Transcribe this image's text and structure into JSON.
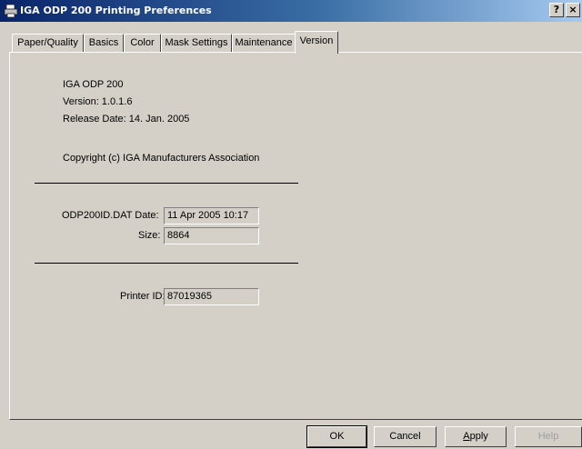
{
  "window": {
    "title": "IGA ODP 200 Printing Preferences",
    "help_button": "?",
    "close_button": "×"
  },
  "tabs": [
    {
      "label": "Paper/Quality"
    },
    {
      "label": "Basics"
    },
    {
      "label": "Color"
    },
    {
      "label": "Mask Settings"
    },
    {
      "label": "Maintenance"
    },
    {
      "label": "Version",
      "active": true
    }
  ],
  "version_panel": {
    "product_name": "IGA ODP 200",
    "version": "Version:  1.0.1.6",
    "release_date": "Release Date: 14. Jan. 2005",
    "copyright": "Copyright (c)  IGA Manufacturers Association",
    "datfile_date_label": "ODP200ID.DAT  Date:",
    "datfile_date_value": "11 Apr 2005  10:17",
    "size_label": "Size:",
    "size_value": "8864",
    "printer_id_label": "Printer ID:",
    "printer_id_value": "87019365"
  },
  "buttons": {
    "ok": "OK",
    "cancel": "Cancel",
    "apply": "Apply",
    "help": "Help"
  }
}
